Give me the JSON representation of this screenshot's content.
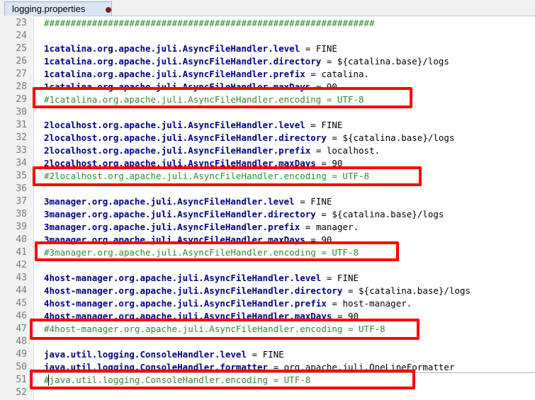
{
  "tab": {
    "title": "logging.properties"
  },
  "lines": [
    {
      "n": "23",
      "segs": [
        {
          "t": "c",
          "v": "##############################################################"
        }
      ]
    },
    {
      "n": "24",
      "segs": []
    },
    {
      "n": "25",
      "segs": [
        {
          "t": "k",
          "v": "1catalina.org.apache.juli.AsyncFileHandler.level"
        },
        {
          "t": "op",
          "v": " = "
        },
        {
          "t": "v",
          "v": "FINE"
        }
      ]
    },
    {
      "n": "26",
      "segs": [
        {
          "t": "k",
          "v": "1catalina.org.apache.juli.AsyncFileHandler.directory"
        },
        {
          "t": "op",
          "v": " = "
        },
        {
          "t": "v",
          "v": "${catalina.base}/logs"
        }
      ]
    },
    {
      "n": "27",
      "segs": [
        {
          "t": "k",
          "v": "1catalina.org.apache.juli.AsyncFileHandler.prefix"
        },
        {
          "t": "op",
          "v": " = "
        },
        {
          "t": "v",
          "v": "catalina."
        }
      ]
    },
    {
      "n": "28",
      "segs": [
        {
          "t": "k",
          "v": "1catalina.org.apache.juli.AsyncFileHandler.maxDays"
        },
        {
          "t": "op",
          "v": " = "
        },
        {
          "t": "v",
          "v": "90"
        }
      ]
    },
    {
      "n": "29",
      "segs": [
        {
          "t": "c",
          "v": "#1catalina.org.apache.juli.AsyncFileHandler.encoding = UTF-8"
        }
      ]
    },
    {
      "n": "30",
      "segs": []
    },
    {
      "n": "31",
      "segs": [
        {
          "t": "k",
          "v": "2localhost.org.apache.juli.AsyncFileHandler.level"
        },
        {
          "t": "op",
          "v": " = "
        },
        {
          "t": "v",
          "v": "FINE"
        }
      ]
    },
    {
      "n": "32",
      "segs": [
        {
          "t": "k",
          "v": "2localhost.org.apache.juli.AsyncFileHandler.directory"
        },
        {
          "t": "op",
          "v": " = "
        },
        {
          "t": "v",
          "v": "${catalina.base}/logs"
        }
      ]
    },
    {
      "n": "33",
      "segs": [
        {
          "t": "k",
          "v": "2localhost.org.apache.juli.AsyncFileHandler.prefix"
        },
        {
          "t": "op",
          "v": " = "
        },
        {
          "t": "v",
          "v": "localhost."
        }
      ]
    },
    {
      "n": "34",
      "segs": [
        {
          "t": "k",
          "v": "2localhost.org.apache.juli.AsyncFileHandler.maxDays"
        },
        {
          "t": "op",
          "v": " = "
        },
        {
          "t": "v",
          "v": "90"
        }
      ]
    },
    {
      "n": "35",
      "segs": [
        {
          "t": "c",
          "v": "#2localhost.org.apache.juli.AsyncFileHandler.encoding = UTF-8"
        }
      ]
    },
    {
      "n": "36",
      "segs": []
    },
    {
      "n": "37",
      "segs": [
        {
          "t": "k",
          "v": "3manager.org.apache.juli.AsyncFileHandler.level"
        },
        {
          "t": "op",
          "v": " = "
        },
        {
          "t": "v",
          "v": "FINE"
        }
      ]
    },
    {
      "n": "38",
      "segs": [
        {
          "t": "k",
          "v": "3manager.org.apache.juli.AsyncFileHandler.directory"
        },
        {
          "t": "op",
          "v": " = "
        },
        {
          "t": "v",
          "v": "${catalina.base}/logs"
        }
      ]
    },
    {
      "n": "39",
      "segs": [
        {
          "t": "k",
          "v": "3manager.org.apache.juli.AsyncFileHandler.prefix"
        },
        {
          "t": "op",
          "v": " = "
        },
        {
          "t": "v",
          "v": "manager."
        }
      ]
    },
    {
      "n": "40",
      "segs": [
        {
          "t": "k",
          "v": "3manager.org.apache.juli.AsyncFileHandler.maxDays"
        },
        {
          "t": "op",
          "v": " = "
        },
        {
          "t": "v",
          "v": "90"
        }
      ]
    },
    {
      "n": "41",
      "segs": [
        {
          "t": "c",
          "v": "#3manager.org.apache.juli.AsyncFileHandler.encoding = UTF-8"
        }
      ]
    },
    {
      "n": "42",
      "segs": []
    },
    {
      "n": "43",
      "segs": [
        {
          "t": "k",
          "v": "4host-manager.org.apache.juli.AsyncFileHandler.level"
        },
        {
          "t": "op",
          "v": " = "
        },
        {
          "t": "v",
          "v": "FINE"
        }
      ]
    },
    {
      "n": "44",
      "segs": [
        {
          "t": "k",
          "v": "4host-manager.org.apache.juli.AsyncFileHandler.directory"
        },
        {
          "t": "op",
          "v": " = "
        },
        {
          "t": "v",
          "v": "${catalina.base}/logs"
        }
      ]
    },
    {
      "n": "45",
      "segs": [
        {
          "t": "k",
          "v": "4host-manager.org.apache.juli.AsyncFileHandler.prefix"
        },
        {
          "t": "op",
          "v": " = "
        },
        {
          "t": "v",
          "v": "host-manager."
        }
      ]
    },
    {
      "n": "46",
      "segs": [
        {
          "t": "k",
          "v": "4host-manager.org.apache.juli.AsyncFileHandler.maxDays"
        },
        {
          "t": "op",
          "v": " = "
        },
        {
          "t": "v",
          "v": "90"
        }
      ]
    },
    {
      "n": "47",
      "segs": [
        {
          "t": "c",
          "v": "#4host-manager.org.apache.juli.AsyncFileHandler.encoding = UTF-8"
        }
      ]
    },
    {
      "n": "48",
      "segs": []
    },
    {
      "n": "49",
      "segs": [
        {
          "t": "k",
          "v": "java.util.logging.ConsoleHandler.level"
        },
        {
          "t": "op",
          "v": " = "
        },
        {
          "t": "v",
          "v": "FINE"
        }
      ]
    },
    {
      "n": "50",
      "segs": [
        {
          "t": "k",
          "v": "java.util.logging.ConsoleHandler.formatter"
        },
        {
          "t": "op",
          "v": " = "
        },
        {
          "t": "v",
          "v": "org.apache.juli.OneLineFormatter"
        }
      ]
    },
    {
      "n": "51",
      "segs": [
        {
          "t": "c",
          "v": "#java.util.logging.ConsoleHandler.encoding = UTF-8"
        }
      ]
    },
    {
      "n": "52",
      "segs": []
    }
  ],
  "colors": {
    "highlight": "#ff0000",
    "keyword": "#000080",
    "comment": "#2e8b2e"
  }
}
